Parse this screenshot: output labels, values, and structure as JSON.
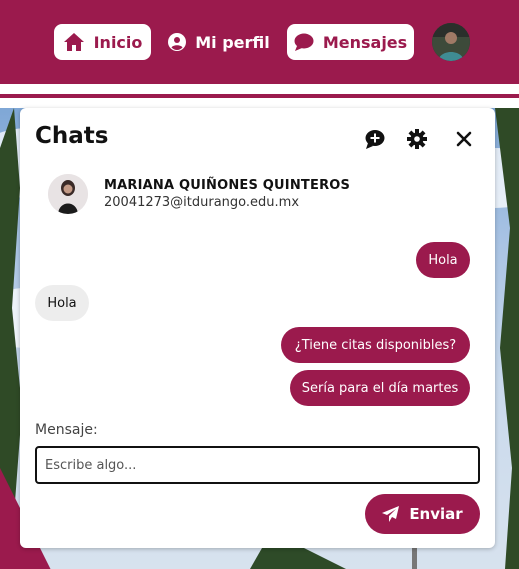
{
  "colors": {
    "brand": "#9b1a4d",
    "bubble_in": "#ededed",
    "white": "#ffffff"
  },
  "nav": {
    "inicio": {
      "label": "Inicio",
      "icon": "home-icon"
    },
    "perfil": {
      "label": "Mi perfil",
      "icon": "user-circle-icon"
    },
    "mensajes": {
      "label": "Mensajes",
      "icon": "chat-bubble-icon"
    }
  },
  "chat": {
    "title": "Chats",
    "header_icons": [
      "new-chat-icon",
      "gear-icon",
      "close-icon"
    ],
    "contact": {
      "name": "MARIANA QUIÑONES QUINTEROS",
      "email": "20041273@itdurango.edu.mx"
    },
    "messages": [
      {
        "from": "me",
        "text": "Hola"
      },
      {
        "from": "contact",
        "text": "Hola"
      },
      {
        "from": "me",
        "text": "¿Tiene citas disponibles?"
      },
      {
        "from": "me",
        "text": "Sería para el día martes"
      }
    ],
    "input_label": "Mensaje:",
    "input_placeholder": "Escribe algo...",
    "input_value": "",
    "send_label": "Enviar"
  }
}
